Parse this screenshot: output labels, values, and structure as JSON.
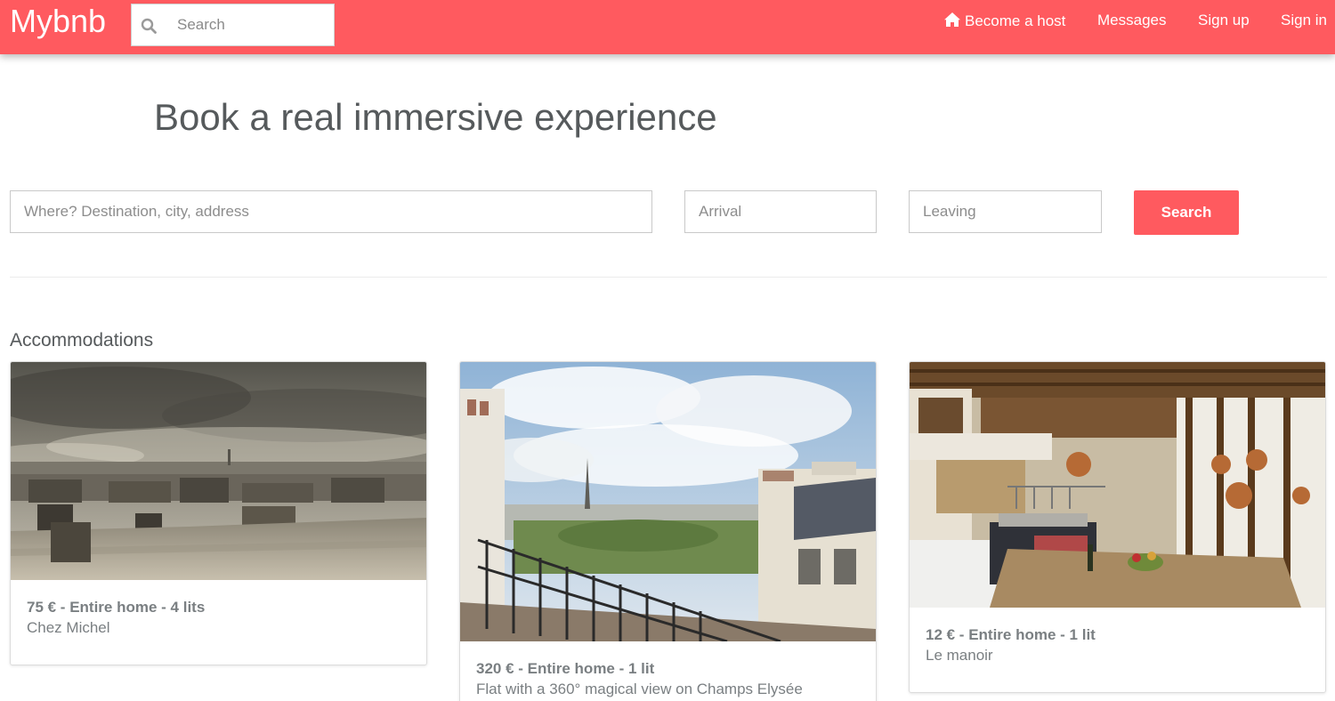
{
  "navbar": {
    "brand": "Mybnb",
    "search_placeholder": "Search",
    "links": [
      {
        "label": "Become a host",
        "icon": "home-icon"
      },
      {
        "label": "Messages"
      },
      {
        "label": "Sign up"
      },
      {
        "label": "Sign in"
      }
    ],
    "color": "#ff5a5f"
  },
  "hero": {
    "title": "Book a real immersive experience"
  },
  "search_form": {
    "where_placeholder": "Where? Destination, city, address",
    "arrival_placeholder": "Arrival",
    "leaving_placeholder": "Leaving",
    "button_label": "Search"
  },
  "accommodations": {
    "title": "Accommodations",
    "cards": [
      {
        "price_line": "75 € - Entire home - 4 lits",
        "name": "Chez Michel",
        "image": "paris-rooftops-photo"
      },
      {
        "price_line": "320 € - Entire home - 1 lit",
        "name": "Flat with a 360° magical view on Champs Elysée",
        "image": "eiffel-balcony-photo"
      },
      {
        "price_line": "12 € - Entire home - 1 lit",
        "name": "Le manoir",
        "image": "manor-kitchen-photo"
      }
    ]
  }
}
